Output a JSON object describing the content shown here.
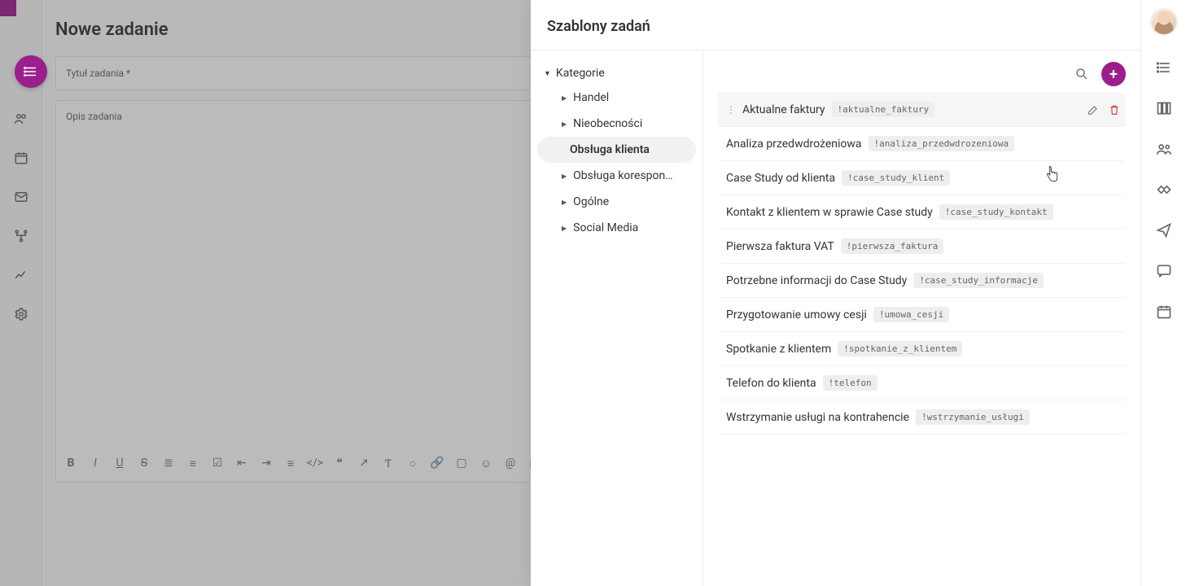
{
  "colors": {
    "accent": "#9c1e8c"
  },
  "page": {
    "title": "Nowe zadanie"
  },
  "form": {
    "title_label": "Tytuł zadania *",
    "desc_label": "Opis zadania"
  },
  "sheet": {
    "title": "Szablony zadań"
  },
  "categories": {
    "root": "Kategorie",
    "items": [
      {
        "label": "Handel"
      },
      {
        "label": "Nieobecności"
      },
      {
        "label": "Obsługa klienta",
        "active": true
      },
      {
        "label": "Obsługa korespon…"
      },
      {
        "label": "Ogólne"
      },
      {
        "label": "Social Media"
      }
    ]
  },
  "templates": [
    {
      "name": "Aktualne faktury",
      "tag": "!aktualne_faktury",
      "hover": true
    },
    {
      "name": "Analiza przedwdrożeniowa",
      "tag": "!analiza_przedwdrozeniowa"
    },
    {
      "name": "Case Study od klienta",
      "tag": "!case_study_klient"
    },
    {
      "name": "Kontakt z klientem w sprawie Case study",
      "tag": "!case_study_kontakt"
    },
    {
      "name": "Pierwsza faktura VAT",
      "tag": "!pierwsza_faktura"
    },
    {
      "name": "Potrzebne informacji do Case Study",
      "tag": "!case_study_informacje"
    },
    {
      "name": "Przygotowanie umowy cesji",
      "tag": "!umowa_cesji"
    },
    {
      "name": "Spotkanie z klientem",
      "tag": "!spotkanie_z_klientem"
    },
    {
      "name": "Telefon do klienta",
      "tag": "!telefon"
    },
    {
      "name": "Wstrzymanie usługi na kontrahencie",
      "tag": "!wstrzymanie_usługi"
    }
  ]
}
